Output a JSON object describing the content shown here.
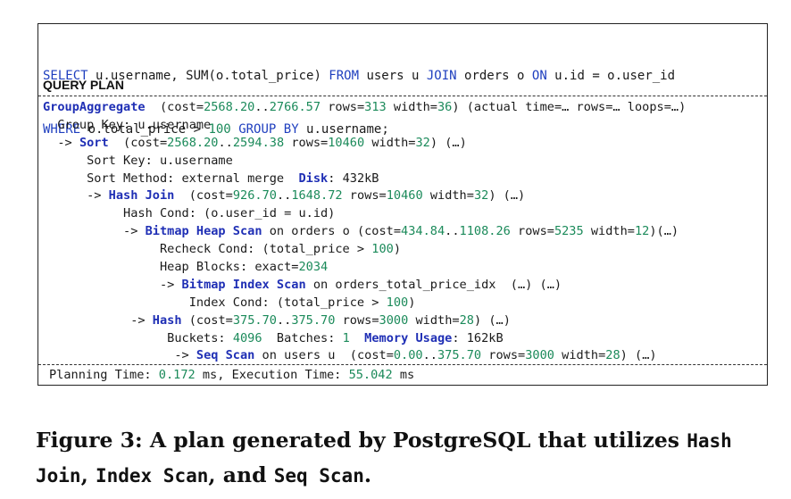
{
  "sql": {
    "line1": [
      {
        "t": "SELECT",
        "c": "kw"
      },
      {
        "t": " u.username, SUM(o.total_price) ",
        "c": ""
      },
      {
        "t": "FROM",
        "c": "kw"
      },
      {
        "t": " users u ",
        "c": ""
      },
      {
        "t": "JOIN",
        "c": "kw"
      },
      {
        "t": " orders o ",
        "c": ""
      },
      {
        "t": "ON",
        "c": "kw"
      },
      {
        "t": " u.id = o.user_id",
        "c": ""
      }
    ],
    "line2": [
      {
        "t": "WHERE",
        "c": "kw"
      },
      {
        "t": " o.total_price > ",
        "c": ""
      },
      {
        "t": "100",
        "c": "num"
      },
      {
        "t": " ",
        "c": ""
      },
      {
        "t": "GROUP BY",
        "c": "kw"
      },
      {
        "t": " u.username;",
        "c": ""
      }
    ]
  },
  "query_plan_title": "QUERY PLAN",
  "plan_lines": [
    {
      "indent": 0,
      "parts": [
        {
          "t": "GroupAggregate",
          "c": "op"
        },
        {
          "t": "  (cost=",
          "c": ""
        },
        {
          "t": "2568.20",
          "c": "num"
        },
        {
          "t": "..",
          "c": ""
        },
        {
          "t": "2766.57",
          "c": "num"
        },
        {
          "t": " rows=",
          "c": ""
        },
        {
          "t": "313",
          "c": "num"
        },
        {
          "t": " width=",
          "c": ""
        },
        {
          "t": "36",
          "c": "num"
        },
        {
          "t": ") (actual time=… rows=… loops=…)",
          "c": ""
        }
      ]
    },
    {
      "indent": 2,
      "parts": [
        {
          "t": "Group Key: u.username",
          "c": ""
        }
      ]
    },
    {
      "indent": 2,
      "parts": [
        {
          "t": "-> ",
          "c": ""
        },
        {
          "t": "Sort",
          "c": "op"
        },
        {
          "t": "  (cost=",
          "c": ""
        },
        {
          "t": "2568.20",
          "c": "num"
        },
        {
          "t": "..",
          "c": ""
        },
        {
          "t": "2594.38",
          "c": "num"
        },
        {
          "t": " rows=",
          "c": ""
        },
        {
          "t": "10460",
          "c": "num"
        },
        {
          "t": " width=",
          "c": ""
        },
        {
          "t": "32",
          "c": "num"
        },
        {
          "t": ") (…)",
          "c": ""
        }
      ]
    },
    {
      "indent": 6,
      "parts": [
        {
          "t": "Sort Key: u.username",
          "c": ""
        }
      ]
    },
    {
      "indent": 6,
      "parts": [
        {
          "t": "Sort Method: external merge  ",
          "c": ""
        },
        {
          "t": "Disk",
          "c": "op"
        },
        {
          "t": ": 432kB",
          "c": ""
        }
      ]
    },
    {
      "indent": 6,
      "parts": [
        {
          "t": "-> ",
          "c": ""
        },
        {
          "t": "Hash Join",
          "c": "op"
        },
        {
          "t": "  (cost=",
          "c": ""
        },
        {
          "t": "926.70",
          "c": "num"
        },
        {
          "t": "..",
          "c": ""
        },
        {
          "t": "1648.72",
          "c": "num"
        },
        {
          "t": " rows=",
          "c": ""
        },
        {
          "t": "10460",
          "c": "num"
        },
        {
          "t": " width=",
          "c": ""
        },
        {
          "t": "32",
          "c": "num"
        },
        {
          "t": ") (…)",
          "c": ""
        }
      ]
    },
    {
      "indent": 11,
      "parts": [
        {
          "t": "Hash Cond: (o.user_id = u.id)",
          "c": ""
        }
      ]
    },
    {
      "indent": 11,
      "parts": [
        {
          "t": "-> ",
          "c": ""
        },
        {
          "t": "Bitmap Heap Scan",
          "c": "op"
        },
        {
          "t": " on orders o (cost=",
          "c": ""
        },
        {
          "t": "434.84",
          "c": "num"
        },
        {
          "t": "..",
          "c": ""
        },
        {
          "t": "1108.26",
          "c": "num"
        },
        {
          "t": " rows=",
          "c": ""
        },
        {
          "t": "5235",
          "c": "num"
        },
        {
          "t": " width=",
          "c": ""
        },
        {
          "t": "12",
          "c": "num"
        },
        {
          "t": ")(…)",
          "c": ""
        }
      ]
    },
    {
      "indent": 16,
      "parts": [
        {
          "t": "Recheck Cond: (total_price > ",
          "c": ""
        },
        {
          "t": "100",
          "c": "num"
        },
        {
          "t": ")",
          "c": ""
        }
      ]
    },
    {
      "indent": 16,
      "parts": [
        {
          "t": "Heap Blocks: exact=",
          "c": ""
        },
        {
          "t": "2034",
          "c": "num"
        }
      ]
    },
    {
      "indent": 16,
      "parts": [
        {
          "t": "-> ",
          "c": ""
        },
        {
          "t": "Bitmap Index Scan",
          "c": "op"
        },
        {
          "t": " on orders_total_price_idx  (…) (…)",
          "c": ""
        }
      ]
    },
    {
      "indent": 20,
      "parts": [
        {
          "t": "Index Cond: (total_price > ",
          "c": ""
        },
        {
          "t": "100",
          "c": "num"
        },
        {
          "t": ")",
          "c": ""
        }
      ]
    },
    {
      "indent": 12,
      "parts": [
        {
          "t": "-> ",
          "c": ""
        },
        {
          "t": "Hash",
          "c": "op"
        },
        {
          "t": " (cost=",
          "c": ""
        },
        {
          "t": "375.70",
          "c": "num"
        },
        {
          "t": "..",
          "c": ""
        },
        {
          "t": "375.70",
          "c": "num"
        },
        {
          "t": " rows=",
          "c": ""
        },
        {
          "t": "3000",
          "c": "num"
        },
        {
          "t": " width=",
          "c": ""
        },
        {
          "t": "28",
          "c": "num"
        },
        {
          "t": ") (…)",
          "c": ""
        }
      ]
    },
    {
      "indent": 17,
      "parts": [
        {
          "t": "Buckets: ",
          "c": ""
        },
        {
          "t": "4096",
          "c": "num"
        },
        {
          "t": "  Batches: ",
          "c": ""
        },
        {
          "t": "1",
          "c": "num"
        },
        {
          "t": "  ",
          "c": ""
        },
        {
          "t": "Memory Usage",
          "c": "op"
        },
        {
          "t": ": 162kB",
          "c": ""
        }
      ]
    },
    {
      "indent": 18,
      "parts": [
        {
          "t": "-> ",
          "c": ""
        },
        {
          "t": "Seq Scan",
          "c": "op"
        },
        {
          "t": " on users u  (cost=",
          "c": ""
        },
        {
          "t": "0.00",
          "c": "num"
        },
        {
          "t": "..",
          "c": ""
        },
        {
          "t": "375.70",
          "c": "num"
        },
        {
          "t": " rows=",
          "c": ""
        },
        {
          "t": "3000",
          "c": "num"
        },
        {
          "t": " width=",
          "c": ""
        },
        {
          "t": "28",
          "c": "num"
        },
        {
          "t": ") (…)",
          "c": ""
        }
      ]
    }
  ],
  "timing": [
    {
      "t": "Planning Time: ",
      "c": ""
    },
    {
      "t": "0.172",
      "c": "num"
    },
    {
      "t": " ms, Execution Time: ",
      "c": ""
    },
    {
      "t": "55.042",
      "c": "num"
    },
    {
      "t": " ms",
      "c": ""
    }
  ],
  "caption": {
    "part1": "Figure 3: A plan generated by PostgreSQL that utilizes ",
    "mono1": "Hash",
    "part2": "Join",
    "part3": ", ",
    "mono2": "Index Scan",
    "part4": ", and ",
    "mono3": "Seq Scan",
    "part5": "."
  }
}
